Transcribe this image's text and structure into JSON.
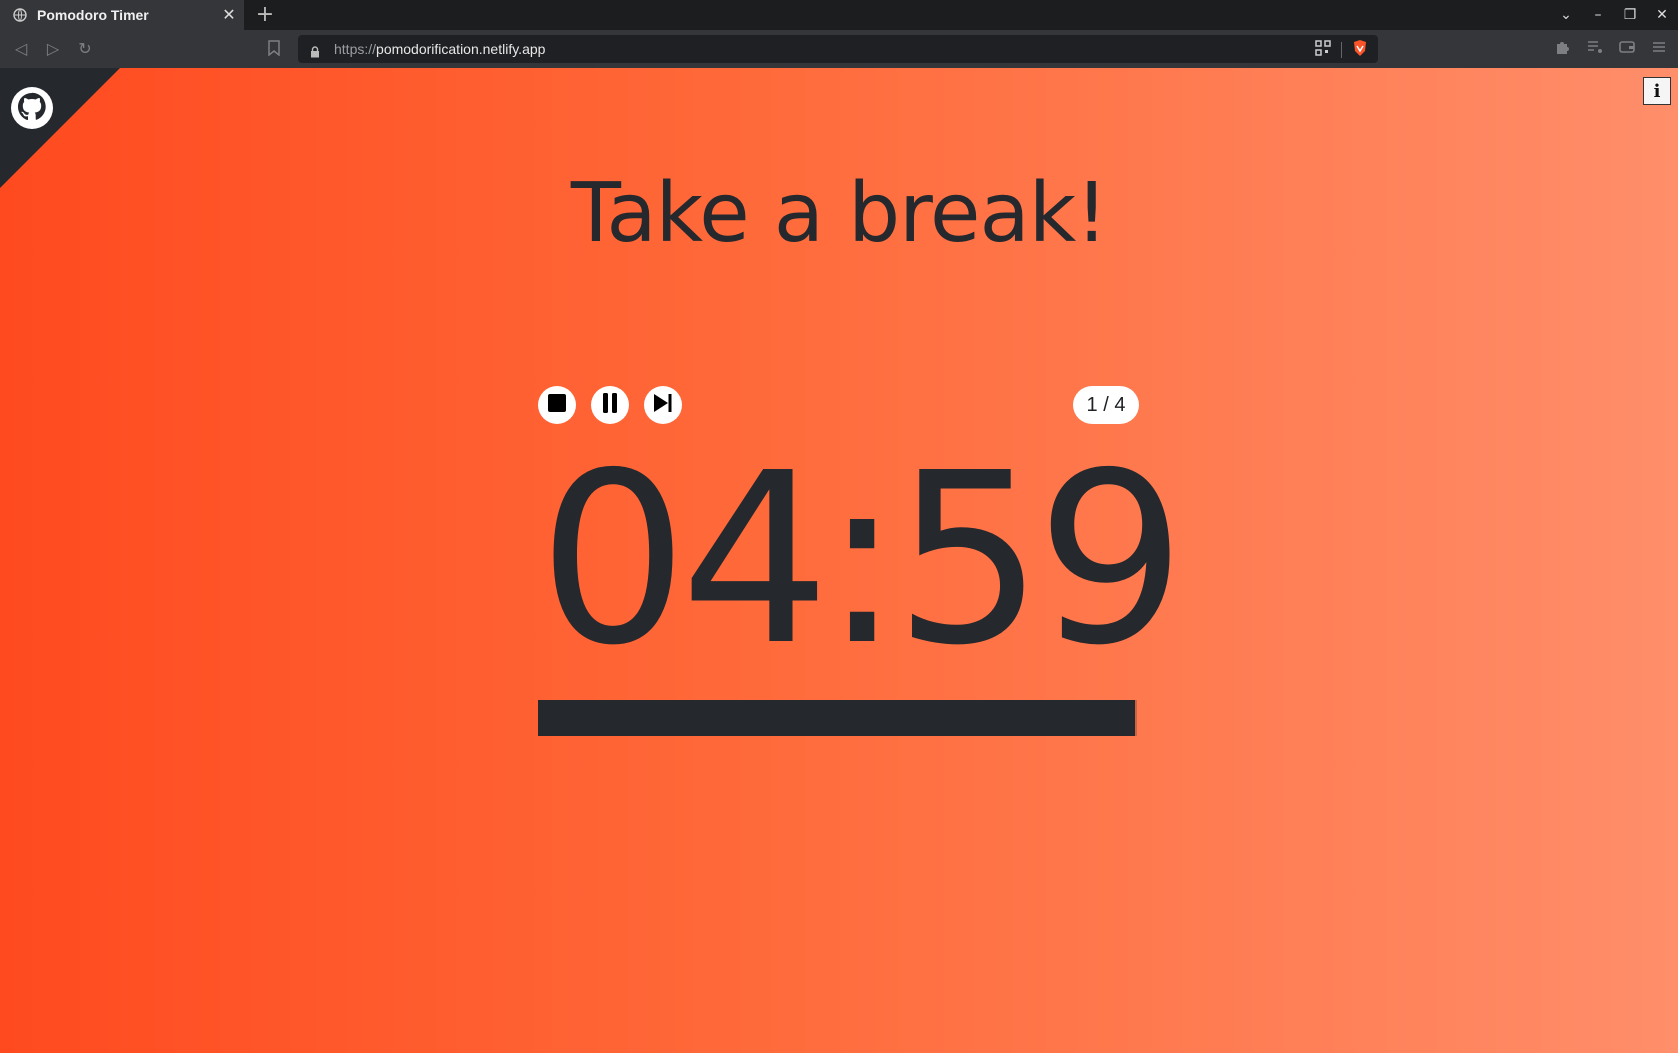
{
  "browser": {
    "tab_title": "Pomodoro Timer",
    "tab_close": "✕",
    "new_tab": "+",
    "url_scheme": "https://",
    "url_host": "pomodorification.netlify.app",
    "window_controls": [
      "–",
      "❐",
      "✕"
    ]
  },
  "page": {
    "github_icon": "github-icon",
    "info_label": "i",
    "heading": "Take a break!",
    "controls": {
      "stop": "stop-icon",
      "pause": "pause-icon",
      "skip": "skip-next-icon"
    },
    "session_counter": "1 / 4",
    "timer": "04:59",
    "progress_fraction": 0.997,
    "colors": {
      "accent_start": "#ff4a1f",
      "accent_end": "#ff8e6a",
      "ink": "#25282c"
    }
  }
}
